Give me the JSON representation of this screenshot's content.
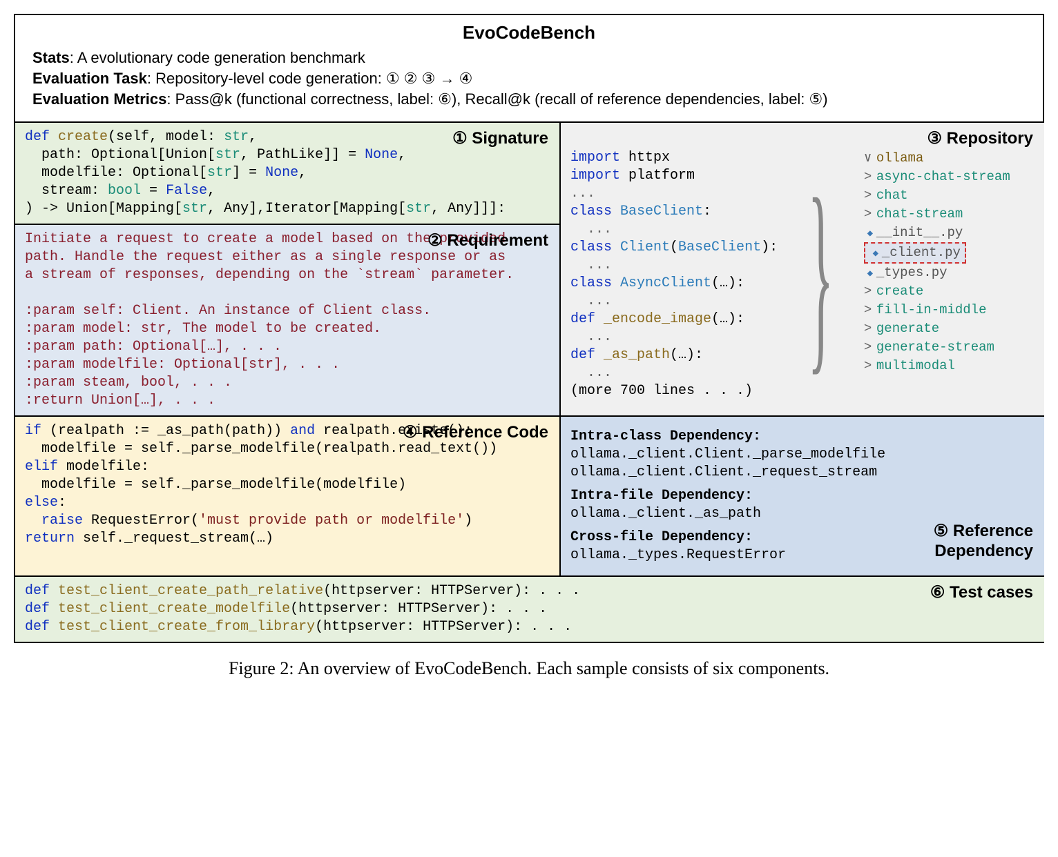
{
  "title": "EvoCodeBench",
  "header": {
    "stats_label": "Stats",
    "stats_text": ": A evolutionary code generation benchmark",
    "task_label": "Evaluation Task",
    "task_text": ": Repository-level code generation: ① ② ③ → ④",
    "metrics_label": "Evaluation Metrics",
    "metrics_text": ": Pass@k (functional correctness, label: ⑥), Recall@k (recall of reference dependencies, label: ⑤)"
  },
  "panels": {
    "signature": {
      "title": "① Signature"
    },
    "requirement": {
      "title": "② Requirement"
    },
    "refcode": {
      "title": "④ Reference Code"
    },
    "repository": {
      "title": "③ Repository"
    },
    "dependency": {
      "title_l1": "⑤ Reference",
      "title_l2": "Dependency"
    },
    "tests": {
      "title": "⑥ Test cases"
    }
  },
  "signature": {
    "l1a": "def ",
    "l1b": "create",
    "l1c": "(self, model: ",
    "l1d": "str",
    "l1e": ",",
    "l2a": "  path: Optional[Union[",
    "l2b": "str",
    "l2c": ", PathLike]] = ",
    "l2d": "None",
    "l2e": ",",
    "l3a": "  modelfile: Optional[",
    "l3b": "str",
    "l3c": "] = ",
    "l3d": "None",
    "l3e": ",",
    "l4a": "  stream: ",
    "l4b": "bool",
    "l4c": " = ",
    "l4d": "False",
    "l4e": ",",
    "l5a": ") -> Union[Mapping[",
    "l5b": "str",
    "l5c": ", Any],Iterator[Mapping[",
    "l5d": "str",
    "l5e": ", Any]]]:"
  },
  "requirement_text": "Initiate a request to create a model based on the provided\npath. Handle the request either as a single response or as\na stream of responses, depending on the `stream` parameter.\n\n:param self: Client. An instance of Client class.\n:param model: str, The model to be created.\n:param path: Optional[…], . . .\n:param modelfile: Optional[str], . . .\n:param steam, bool, . . .\n:return Union[…], . . .",
  "refcode": {
    "l1a": "if ",
    "l1b": "(realpath := _as_path(path)) ",
    "l1c": "and",
    "l1d": " realpath.exists():",
    "l2": "  modelfile = self._parse_modelfile(realpath.read_text())",
    "l3a": "elif ",
    "l3b": "modelfile:",
    "l4": "  modelfile = self._parse_modelfile(modelfile)",
    "l5a": "else",
    "l5b": ":",
    "l6a": "  raise ",
    "l6b": "RequestError(",
    "l6c": "'must provide path or modelfile'",
    "l6d": ")",
    "l7a": "return ",
    "l7b": "self._request_stream(…)"
  },
  "repocode": {
    "l1a": "import ",
    "l1b": "httpx",
    "l2a": "import ",
    "l2b": "platform",
    "l3": "...",
    "l4a": "class ",
    "l4b": "BaseClient",
    "l4c": ":",
    "l5": "  ...",
    "l6a": "class ",
    "l6b": "Client",
    "l6c": "(",
    "l6d": "BaseClient",
    "l6e": "):",
    "l7": "  ...",
    "l8a": "class ",
    "l8b": "AsyncClient",
    "l8c": "(…):",
    "l9": "  ...",
    "l10a": "def ",
    "l10b": "_encode_image",
    "l10c": "(…):",
    "l11": "  ...",
    "l12a": "def ",
    "l12b": "_as_path",
    "l12c": "(…):",
    "l13": "  ...",
    "l14": "(more 700 lines . . .)"
  },
  "tree": {
    "root": "ollama",
    "items": [
      "async-chat-stream",
      "chat",
      "chat-stream"
    ],
    "py1": "__init__.py",
    "py2": "_client.py",
    "py3": "_types.py",
    "items2": [
      "create",
      "fill-in-middle",
      "generate",
      "generate-stream",
      "multimodal"
    ]
  },
  "dep": {
    "intra_class_h": "Intra-class Dependency:",
    "intra_class_1": "ollama._client.Client._parse_modelfile",
    "intra_class_2": "ollama._client.Client._request_stream",
    "intra_file_h": "Intra-file Dependency:",
    "intra_file_1": "ollama._client._as_path",
    "cross_file_h": "Cross-file Dependency:",
    "cross_file_1": "ollama._types.RequestError"
  },
  "tests": {
    "l1a": "def ",
    "l1b": "test_client_create_path_relative",
    "l1c": "(httpserver: HTTPServer): . . .",
    "l2a": "def ",
    "l2b": "test_client_create_modelfile",
    "l2c": "(httpserver: HTTPServer): . . .",
    "l3a": "def ",
    "l3b": "test_client_create_from_library",
    "l3c": "(httpserver: HTTPServer): . . ."
  },
  "caption": "Figure 2: An overview of EvoCodeBench. Each sample consists of six components."
}
